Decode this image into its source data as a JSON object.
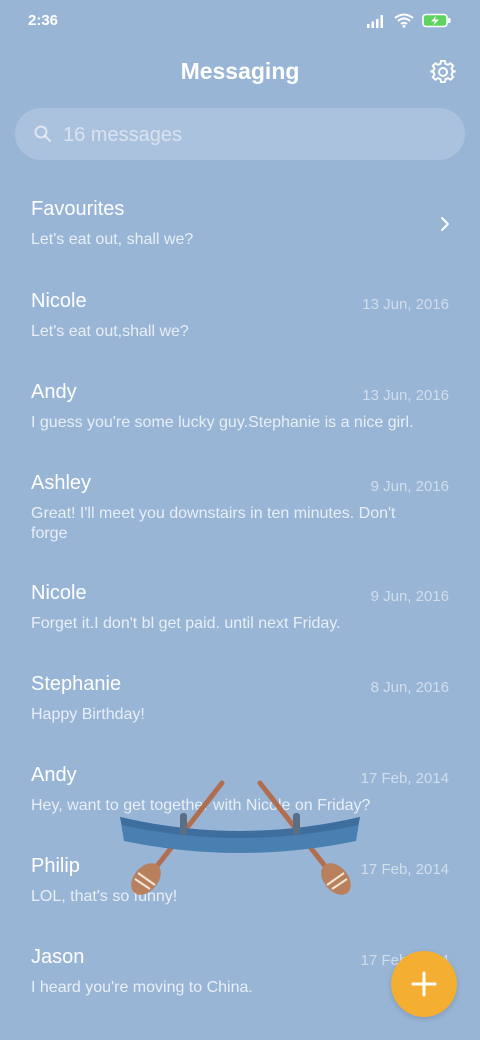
{
  "status": {
    "time": "2:36"
  },
  "header": {
    "title": "Messaging"
  },
  "search": {
    "placeholder": "16 messages"
  },
  "favourites": {
    "name": "Favourites",
    "preview": "Let's eat out, shall we?"
  },
  "threads": [
    {
      "name": "Nicole",
      "date": "13 Jun, 2016",
      "preview": "Let's eat out,shall we?"
    },
    {
      "name": "Andy",
      "date": "13 Jun, 2016",
      "preview": "I guess you're some lucky guy.Stephanie is a nice girl."
    },
    {
      "name": "Ashley",
      "date": "9 Jun, 2016",
      "preview": "Great! I'll meet you downstairs in ten minutes. Don't forge"
    },
    {
      "name": "Nicole",
      "date": "9 Jun, 2016",
      "preview": "Forget it.I don't bl get paid. until next Friday."
    },
    {
      "name": "Stephanie",
      "date": "8 Jun, 2016",
      "preview": "Happy Birthday!"
    },
    {
      "name": "Andy",
      "date": "17 Feb, 2014",
      "preview": "Hey, want to get together with Nicole on Friday?"
    },
    {
      "name": "Philip",
      "date": "17 Feb, 2014",
      "preview": "LOL, that's so funny!"
    },
    {
      "name": "Jason",
      "date": "17 Feb, 2014",
      "preview": "I heard you're moving to China."
    }
  ],
  "icons": {
    "settings": "gear-icon",
    "search": "search-icon",
    "chevron": "chevron-right-icon",
    "fab": "plus-icon",
    "signal": "signal-icon",
    "wifi": "wifi-icon",
    "battery": "battery-charging-icon"
  },
  "colors": {
    "background": "#98b5d6",
    "fab": "#f4ae32",
    "battery": "#5fd35f"
  }
}
